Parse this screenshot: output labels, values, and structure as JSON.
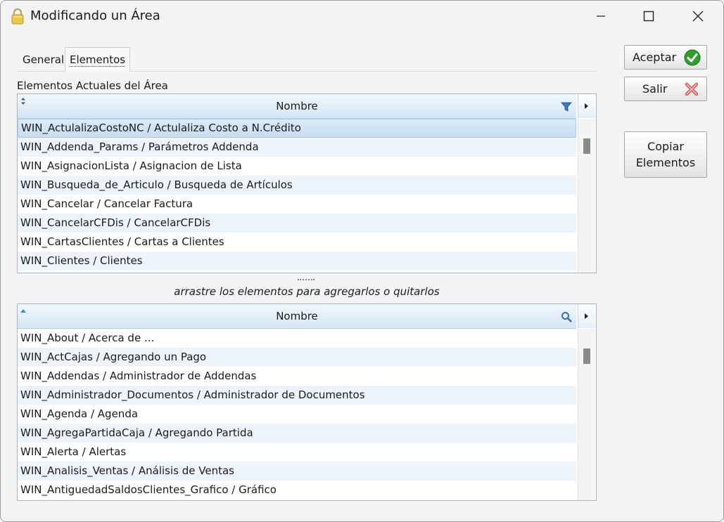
{
  "window": {
    "title": "Modificando un Área"
  },
  "tabs": [
    {
      "label": "General",
      "active": false
    },
    {
      "label": "Elementos",
      "active": true
    }
  ],
  "current_section_label": "Elementos Actuales del Área",
  "top_list": {
    "column_header": "Nombre",
    "rows": [
      "WIN_ActulalizaCostoNC / Actulaliza Costo a N.Crédito",
      "WIN_Addenda_Params / Parámetros Addenda",
      "WIN_AsignacionLista / Asignacion de Lista",
      "WIN_Busqueda_de_Articulo / Busqueda de Artículos",
      "WIN_Cancelar / Cancelar Factura",
      "WIN_CancelarCFDis / CancelarCFDis",
      "WIN_CartasClientes / Cartas a Clientes",
      "WIN_Clientes / Clientes"
    ],
    "selected_index": 0
  },
  "drag_hint": "arrastre los elementos para agregarlos o quitarlos",
  "bottom_list": {
    "column_header": "Nombre",
    "rows": [
      "WIN_About / Acerca de ...",
      "WIN_ActCajas / Agregando un Pago",
      "WIN_Addendas / Administrador de Addendas",
      "WIN_Administrador_Documentos / Administrador de Documentos",
      "WIN_Agenda / Agenda",
      "WIN_AgregaPartidaCaja / Agregando Partida",
      "WIN_Alerta / Alertas",
      "WIN_Analisis_Ventas / Análisis de Ventas",
      "WIN_AntiguedadSaldosClientes_Grafico / Gráfico"
    ]
  },
  "buttons": {
    "accept": "Aceptar",
    "exit": "Salir",
    "copy_line1": "Copiar",
    "copy_line2": "Elementos"
  },
  "colors": {
    "accept_icon": "#2e9e2e",
    "exit_icon": "#d9534f",
    "header_gradient_bottom": "#d3e5f3",
    "alt_row": "#edf4fb"
  },
  "icons": {
    "title": "lock-icon",
    "accept": "check-circle-icon",
    "exit": "x-icon",
    "filter": "filter-icon",
    "search": "magnifier-icon"
  }
}
